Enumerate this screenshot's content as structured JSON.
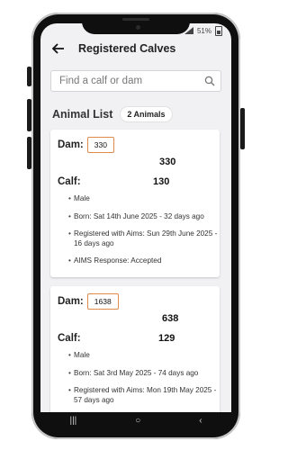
{
  "status": {
    "battery": "51%"
  },
  "header": {
    "title": "Registered Calves"
  },
  "search": {
    "placeholder": "Find a calf or dam"
  },
  "list": {
    "title": "Animal List",
    "count_badge": "2 Animals"
  },
  "labels": {
    "dam": "Dam:",
    "calf": "Calf:"
  },
  "cards": [
    {
      "dam_tag": "330",
      "dam_number": "330",
      "calf_number": "130",
      "details": [
        "Male",
        "Born: Sat 14th June 2025 - 32 days ago",
        "Registered with Aims: Sun 29th June 2025 - 16 days ago",
        "AIMS Response: Accepted"
      ]
    },
    {
      "dam_tag": "1638",
      "dam_number": "638",
      "calf_number": "129",
      "details": [
        "Male",
        "Born: Sat 3rd May 2025 - 74 days ago",
        "Registered with Aims: Mon 19th May 2025 - 57 days ago"
      ]
    }
  ]
}
